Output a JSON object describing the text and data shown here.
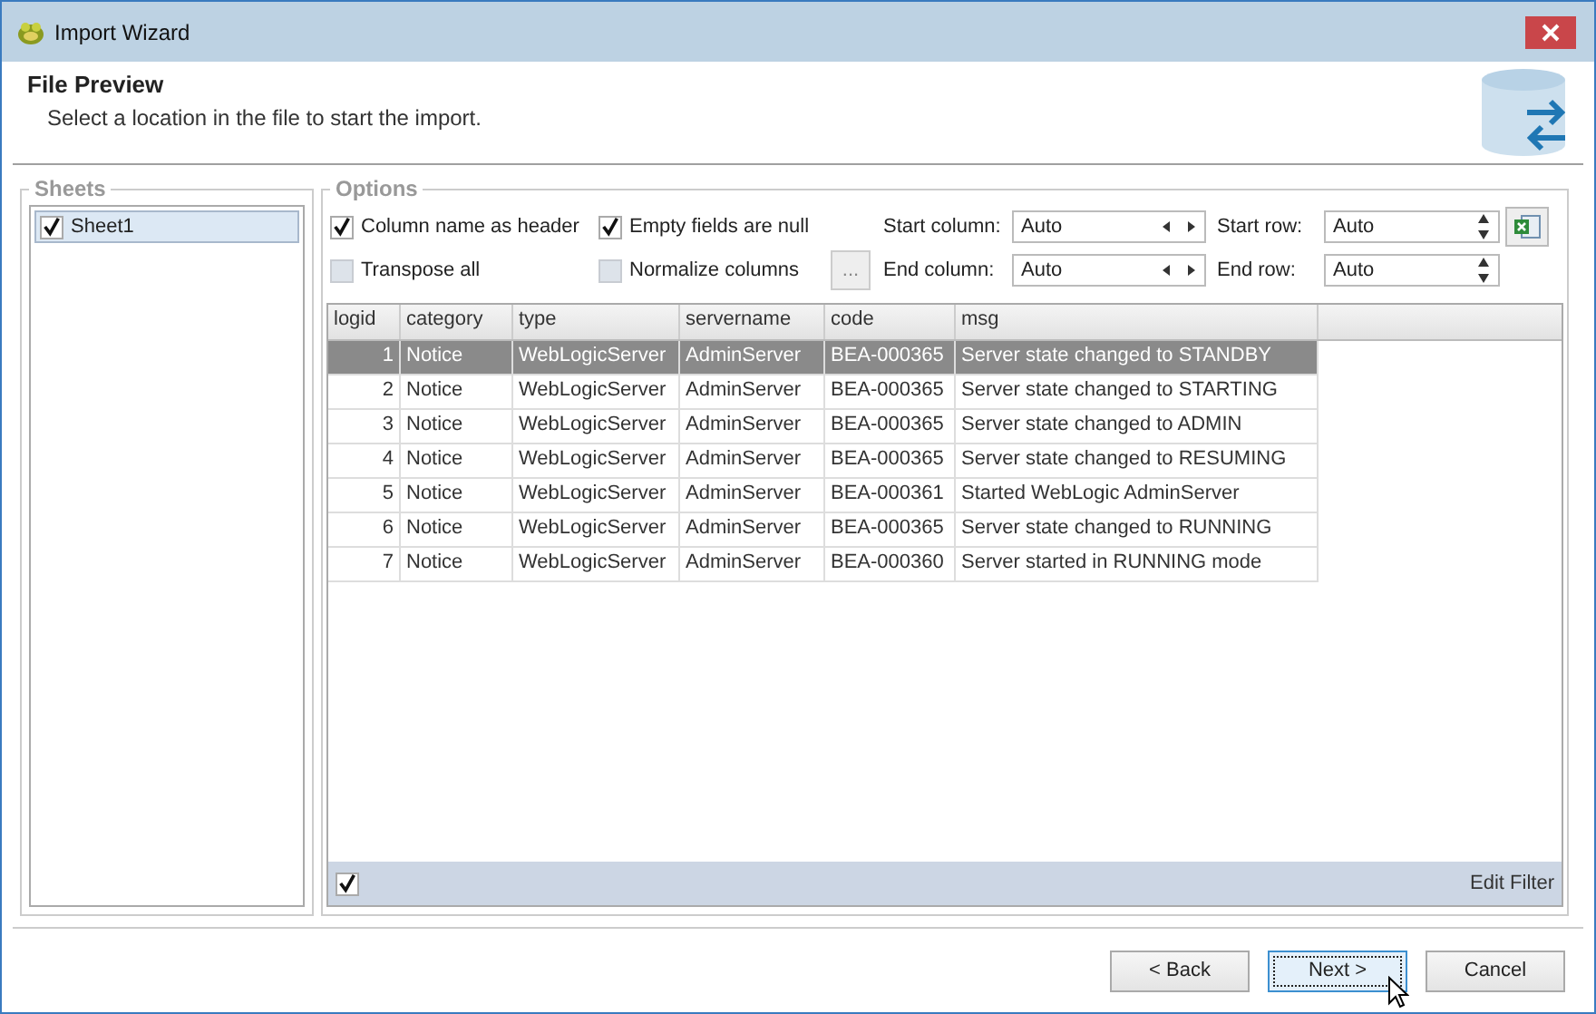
{
  "window": {
    "title": "Import Wizard"
  },
  "header": {
    "title": "File Preview",
    "subtitle": "Select a location in the file to start the import."
  },
  "sheets": {
    "title": "Sheets",
    "items": [
      {
        "label": "Sheet1",
        "checked": true,
        "selected": true
      }
    ]
  },
  "options": {
    "title": "Options",
    "checkboxes": [
      {
        "label": "Column name as header",
        "checked": true
      },
      {
        "label": "Empty fields are null",
        "checked": true
      },
      {
        "label": "Transpose all",
        "checked": false
      },
      {
        "label": "Normalize columns",
        "checked": false
      }
    ],
    "ellipsis_button": "...",
    "ranges": [
      {
        "label": "Start column:",
        "value": "Auto",
        "kind": "horizontal"
      },
      {
        "label": "Start row:",
        "value": "Auto",
        "kind": "vertical"
      },
      {
        "label": "End column:",
        "value": "Auto",
        "kind": "horizontal"
      },
      {
        "label": "End row:",
        "value": "Auto",
        "kind": "vertical"
      }
    ]
  },
  "table": {
    "columns": [
      "logid",
      "category",
      "type",
      "servername",
      "code",
      "msg"
    ],
    "rows": [
      {
        "cells": [
          "1",
          "Notice",
          "WebLogicServer",
          "AdminServer",
          "BEA-000365",
          "Server state changed to STANDBY"
        ],
        "selected": true
      },
      {
        "cells": [
          "2",
          "Notice",
          "WebLogicServer",
          "AdminServer",
          "BEA-000365",
          "Server state changed to STARTING"
        ],
        "selected": false
      },
      {
        "cells": [
          "3",
          "Notice",
          "WebLogicServer",
          "AdminServer",
          "BEA-000365",
          "Server state changed to ADMIN"
        ],
        "selected": false
      },
      {
        "cells": [
          "4",
          "Notice",
          "WebLogicServer",
          "AdminServer",
          "BEA-000365",
          "Server state changed to RESUMING"
        ],
        "selected": false
      },
      {
        "cells": [
          "5",
          "Notice",
          "WebLogicServer",
          "AdminServer",
          "BEA-000361",
          "Started WebLogic AdminServer"
        ],
        "selected": false
      },
      {
        "cells": [
          "6",
          "Notice",
          "WebLogicServer",
          "AdminServer",
          "BEA-000365",
          "Server state changed to RUNNING"
        ],
        "selected": false
      },
      {
        "cells": [
          "7",
          "Notice",
          "WebLogicServer",
          "AdminServer",
          "BEA-000360",
          "Server started in RUNNING mode"
        ],
        "selected": false
      }
    ]
  },
  "filter_bar": {
    "checked": true,
    "link": "Edit Filter"
  },
  "buttons": [
    {
      "label": "< Back",
      "focused": false
    },
    {
      "label": "Next >",
      "focused": true
    },
    {
      "label": "Cancel",
      "focused": false
    }
  ]
}
